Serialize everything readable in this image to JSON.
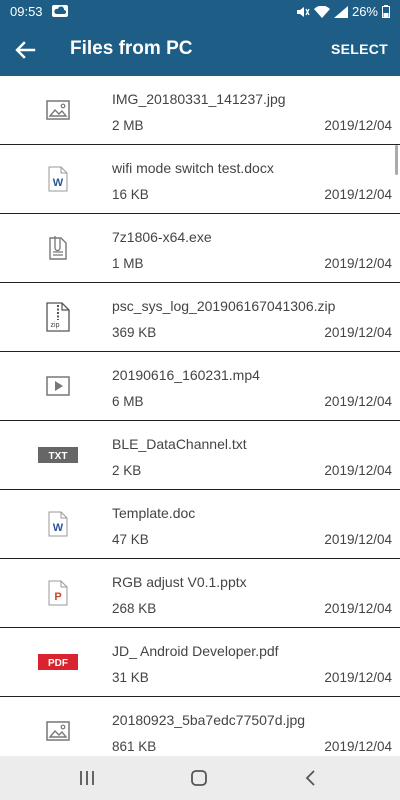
{
  "status": {
    "time": "09:53",
    "battery": "26%"
  },
  "header": {
    "title": "Files from PC",
    "select_label": "SELECT"
  },
  "files": [
    {
      "name": "IMG_20180331_141237.jpg",
      "size": "2 MB",
      "date": "2019/12/04",
      "icon": "image-icon"
    },
    {
      "name": "wifi mode switch test.docx",
      "size": "16 KB",
      "date": "2019/12/04",
      "icon": "word-doc-icon"
    },
    {
      "name": "7z1806-x64.exe",
      "size": "1 MB",
      "date": "2019/12/04",
      "icon": "attachment-file-icon"
    },
    {
      "name": "psc_sys_log_201906167041306.zip",
      "size": "369 KB",
      "date": "2019/12/04",
      "icon": "zip-file-icon"
    },
    {
      "name": "20190616_160231.mp4",
      "size": "6 MB",
      "date": "2019/12/04",
      "icon": "video-icon"
    },
    {
      "name": "BLE_DataChannel.txt",
      "size": "2 KB",
      "date": "2019/12/04",
      "icon": "txt-file-icon",
      "icon_text": "TXT"
    },
    {
      "name": "Template.doc",
      "size": "47 KB",
      "date": "2019/12/04",
      "icon": "word-doc-icon"
    },
    {
      "name": "RGB adjust V0.1.pptx",
      "size": "268 KB",
      "date": "2019/12/04",
      "icon": "powerpoint-icon"
    },
    {
      "name": "JD_ Android Developer.pdf",
      "size": "31 KB",
      "date": "2019/12/04",
      "icon": "pdf-file-icon",
      "icon_text": "PDF"
    },
    {
      "name": "20180923_5ba7edc77507d.jpg",
      "size": "861 KB",
      "date": "2019/12/04",
      "icon": "image-icon"
    }
  ],
  "colors": {
    "app_bar": "#1d5d86",
    "word": "#2b5797",
    "ppt": "#d04423",
    "pdf": "#d9232f",
    "txt": "#666666"
  }
}
